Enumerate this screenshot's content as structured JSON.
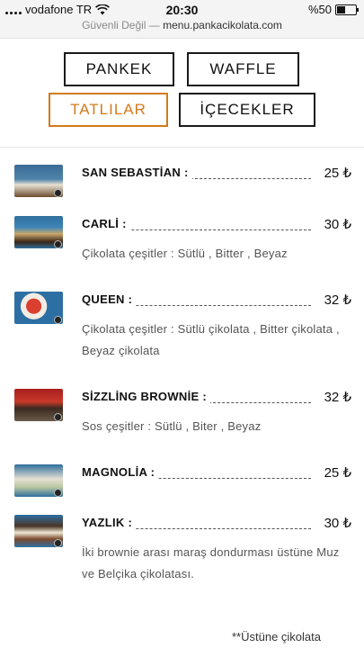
{
  "status": {
    "carrier": "vodafone TR",
    "time": "20:30",
    "battery": "%50",
    "battery_level": 0.5,
    "url_prefix": "Güvenli Değil —",
    "url": "menu.pankacikolata.com"
  },
  "tabs": [
    {
      "label": "PANKEK",
      "active": false
    },
    {
      "label": "WAFFLE",
      "active": false
    },
    {
      "label": "TATLILAR",
      "active": true
    },
    {
      "label": "İÇECEKLER",
      "active": false
    }
  ],
  "items": [
    {
      "name": "SAN SEBASTİAN :",
      "price": "25 ₺",
      "desc": ""
    },
    {
      "name": "CARLİ :",
      "price": "30 ₺",
      "desc": "Çikolata çeşitler : Sütlü , Bitter , Beyaz"
    },
    {
      "name": "QUEEN :",
      "price": "32 ₺",
      "desc": "Çikolata çeşitler : Sütlü çikolata , Bitter çikolata , Beyaz çikolata"
    },
    {
      "name": "SİZZLİNG BROWNİE :",
      "price": "32 ₺",
      "desc": "Sos çeşitler : Sütlü , Biter , Beyaz"
    },
    {
      "name": "MAGNOLİA :",
      "price": "25 ₺",
      "desc": ""
    },
    {
      "name": "YAZLIK :",
      "price": "30 ₺",
      "desc": "İki brownie arası maraş dondurması üstüne Muz ve Belçika çikolatası."
    }
  ],
  "footnote": "**Üstüne çikolata",
  "colors": {
    "accent": "#d47a1a",
    "border": "#1a1a1a",
    "text_muted": "#555555"
  },
  "icons": [
    "wifi-icon",
    "signal-icon",
    "battery-icon"
  ]
}
